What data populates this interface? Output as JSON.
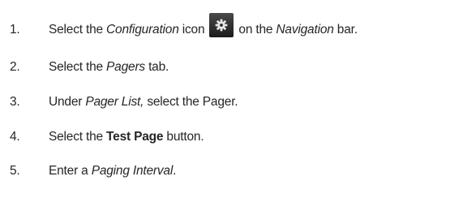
{
  "steps": [
    {
      "number": "1.",
      "parts": {
        "a": "Select the ",
        "b": "Configuration",
        "c": " icon",
        "d": "on the ",
        "e": "Navigation",
        "f": " bar."
      },
      "icon": "gear-icon"
    },
    {
      "number": "2.",
      "parts": {
        "a": "Select the ",
        "b": "Pagers",
        "c": " tab."
      }
    },
    {
      "number": "3.",
      "parts": {
        "a": "Under ",
        "b": "Pager List,",
        "c": " select the Pager."
      }
    },
    {
      "number": "4.",
      "parts": {
        "a": "Select the ",
        "b": "Test Page",
        "c": " button."
      }
    },
    {
      "number": "5.",
      "parts": {
        "a": "Enter a ",
        "b": "Paging Interval",
        "c": "."
      }
    }
  ],
  "colors": {
    "text": "#262626",
    "icon_bg": "#2a2a2a",
    "icon_fg": "#e6e6e6"
  }
}
